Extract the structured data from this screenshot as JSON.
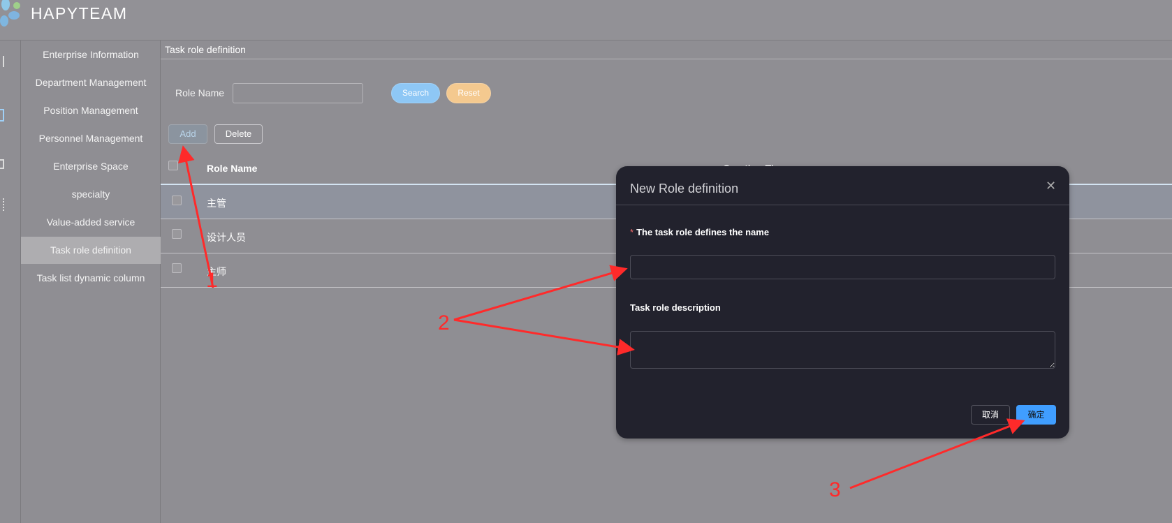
{
  "header": {
    "brand": "HAPYTEAM"
  },
  "sidebar": {
    "items": [
      {
        "label": "Enterprise Information"
      },
      {
        "label": "Department Management"
      },
      {
        "label": "Position Management"
      },
      {
        "label": "Personnel Management"
      },
      {
        "label": "Enterprise Space"
      },
      {
        "label": "specialty"
      },
      {
        "label": "Value-added service"
      },
      {
        "label": "Task role definition",
        "active": true
      },
      {
        "label": "Task list dynamic column"
      }
    ]
  },
  "main": {
    "title": "Task role definition",
    "filter": {
      "label": "Role Name",
      "value": "",
      "search": "Search",
      "reset": "Reset"
    },
    "toolbar": {
      "add": "Add",
      "delete": "Delete"
    },
    "table": {
      "columns": [
        "Role Name",
        "Creation Time"
      ],
      "rows": [
        {
          "name": "主管"
        },
        {
          "name": "设计人员"
        },
        {
          "name": "主师"
        }
      ]
    }
  },
  "dialog": {
    "title": "New Role definition",
    "name_label": "The task role defines the name",
    "required_mark": "*",
    "name_value": "",
    "desc_label": "Task role description",
    "desc_value": "",
    "cancel": "取消",
    "confirm": "确定"
  },
  "annotations": [
    "1",
    "2",
    "3"
  ],
  "colors": {
    "accent": "#409eff",
    "annotation": "#ff2a2a",
    "dialog_bg": "#22222d"
  }
}
